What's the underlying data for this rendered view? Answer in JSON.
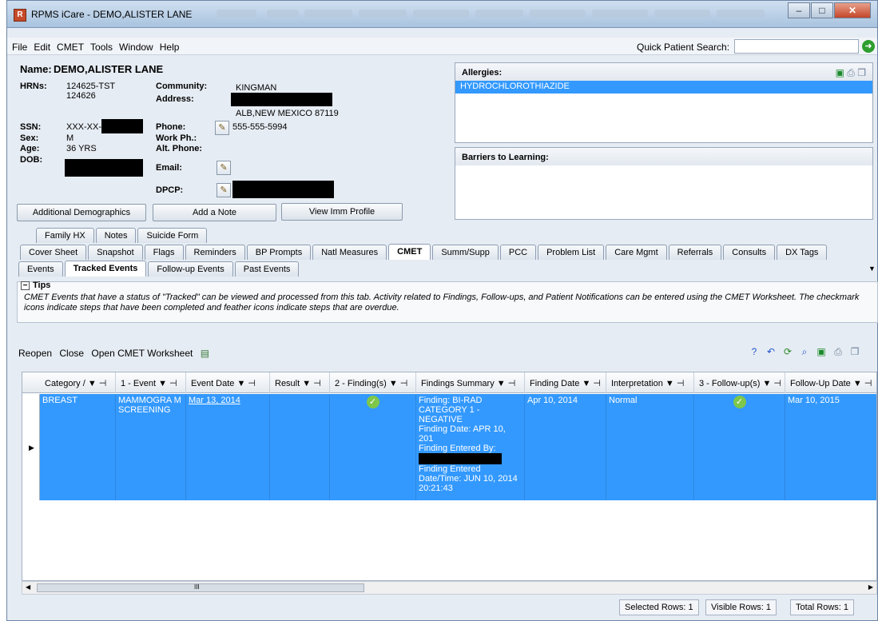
{
  "window": {
    "title": "RPMS iCare - DEMO,ALISTER LANE",
    "logo": "R"
  },
  "menu": {
    "items": [
      "File",
      "Edit",
      "CMET",
      "Tools",
      "Window",
      "Help"
    ],
    "quick_search_label": "Quick Patient Search:",
    "quick_search_value": ""
  },
  "patient": {
    "name_label": "Name:",
    "name": "DEMO,ALISTER LANE",
    "hrns_label": "HRNs:",
    "hrn1": "124625-TST",
    "hrn2": "124626",
    "community_label": "Community:",
    "community": "KINGMAN",
    "address_label": "Address:",
    "address_line2": "ALB,NEW MEXICO 87119",
    "ssn_label": "SSN:",
    "ssn": "XXX-XX-",
    "sex_label": "Sex:",
    "sex": "M",
    "age_label": "Age:",
    "age": "36 YRS",
    "dob_label": "DOB:",
    "phone_label": "Phone:",
    "phone": "555-555-5994",
    "workph_label": "Work Ph.:",
    "altphone_label": "Alt. Phone:",
    "email_label": "Email:",
    "dpcp_label": "DPCP:"
  },
  "buttons": {
    "additional_demographics": "Additional Demographics",
    "add_note": "Add a Note",
    "view_imm": "View Imm Profile"
  },
  "allergies": {
    "title": "Allergies:",
    "items": [
      "HYDROCHLOROTHIAZIDE"
    ]
  },
  "barriers": {
    "title": "Barriers to Learning:"
  },
  "tabs_row1": [
    "Family HX",
    "Notes",
    "Suicide Form"
  ],
  "tabs_row2": [
    "Cover Sheet",
    "Snapshot",
    "Flags",
    "Reminders",
    "BP Prompts",
    "Natl Measures",
    "CMET",
    "Summ/Supp",
    "PCC",
    "Problem List",
    "Care Mgmt",
    "Referrals",
    "Consults",
    "DX Tags"
  ],
  "subtabs": [
    "Events",
    "Tracked Events",
    "Follow-up Events",
    "Past Events"
  ],
  "tips": {
    "title": "Tips",
    "toggle": "−",
    "text": "CMET Events that have a status of \"Tracked\" can be viewed and processed from this tab.  Activity related to Findings, Follow-ups, and Patient Notifications can be entered using the CMET Worksheet. The checkmark icons indicate steps that have been completed and feather icons indicate steps that are overdue."
  },
  "actions": {
    "reopen": "Reopen",
    "close": "Close",
    "open_worksheet": "Open CMET Worksheet"
  },
  "grid": {
    "columns": [
      "Category",
      "1 - Event",
      "Event Date",
      "Result",
      "2 - Finding(s)",
      "Findings Summary",
      "Finding Date",
      "Interpretation",
      "3 - Follow-up(s)",
      "Follow-Up Date"
    ],
    "sort_mark": "/",
    "filter_glyph": "▼ ⊣",
    "row": {
      "category": "BREAST",
      "event": "MAMMOGRA M SCREENING",
      "event_date": "Mar 13, 2014",
      "result": "",
      "finding_summary_1": "Finding: BI-RAD CATEGORY 1 - NEGATIVE",
      "finding_summary_2": "Finding Date: APR 10, 201",
      "finding_summary_3": "Finding Entered By:",
      "finding_summary_4": "Finding Entered Date/Time: JUN 10, 2014 20:21:43",
      "finding_date": "Apr 10, 2014",
      "interpretation": "Normal",
      "followup_date": "Mar 10, 2015"
    },
    "scroll_mark": "III"
  },
  "status": {
    "selected": "Selected Rows: 1",
    "visible": "Visible Rows: 1",
    "total": "Total Rows: 1"
  }
}
